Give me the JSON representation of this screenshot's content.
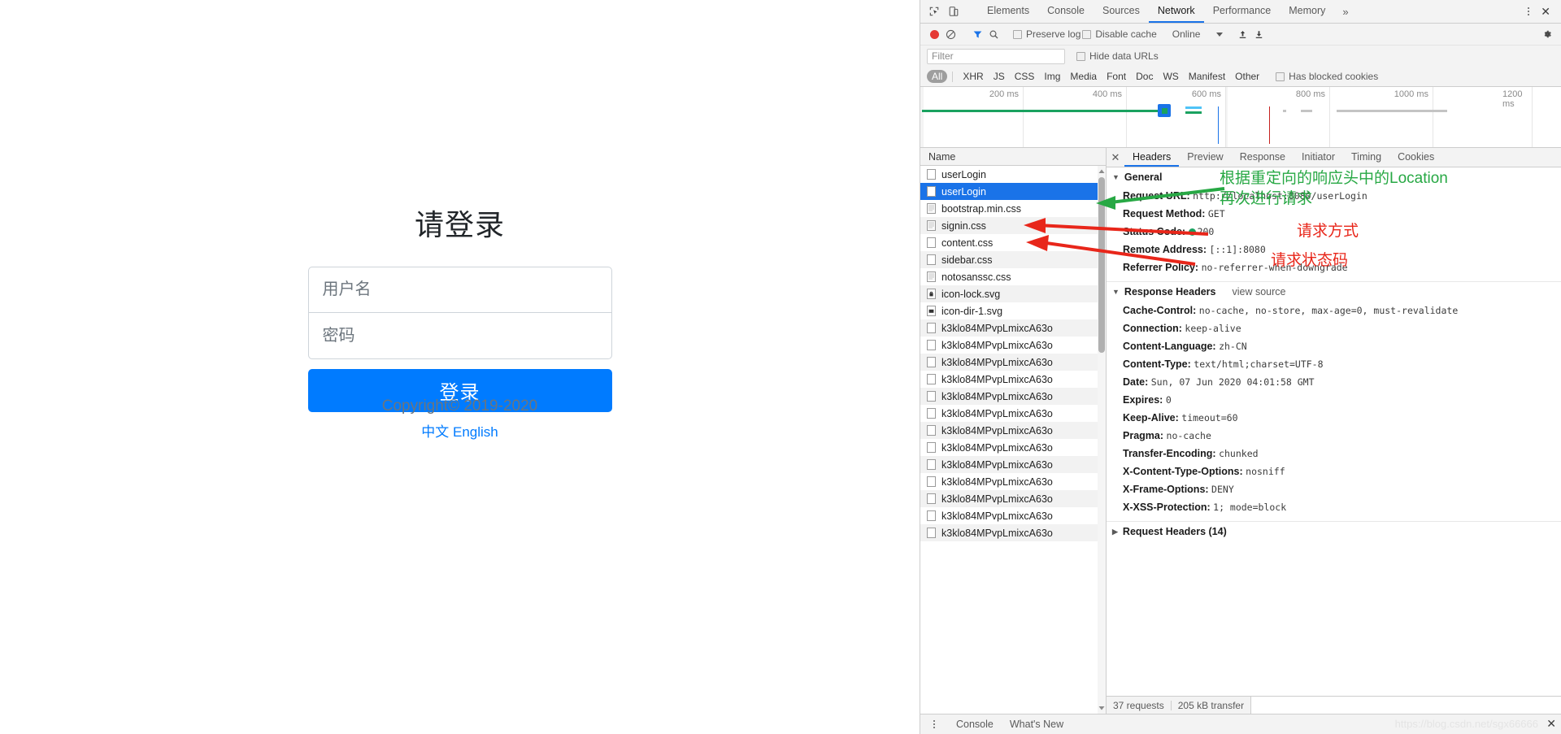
{
  "page": {
    "title": "请登录",
    "username_placeholder": "用户名",
    "password_placeholder": "密码",
    "username_value": "",
    "password_value": "",
    "login_button": "登录",
    "lang_zh": "中文",
    "lang_en": "English",
    "copyright": "Copyright© 2019-2020",
    "accent_color": "#007bff"
  },
  "devtools": {
    "tabs": [
      {
        "label": "Elements",
        "active": false
      },
      {
        "label": "Console",
        "active": false
      },
      {
        "label": "Sources",
        "active": false
      },
      {
        "label": "Network",
        "active": true
      },
      {
        "label": "Performance",
        "active": false
      },
      {
        "label": "Memory",
        "active": false
      }
    ],
    "more_tabs_icon": "chevron-double-right-icon",
    "inspect_icon": "inspect-cursor-icon",
    "device_icon": "device-toolbar-icon",
    "menu_icon": "kebab-menu-icon",
    "close_icon": "close-icon",
    "toolbar": {
      "record_icon": "record-circle-icon",
      "clear_icon": "clear-no-entry-icon",
      "filter_icon": "funnel-filter-icon",
      "search_icon": "search-magnifier-icon",
      "preserve_log": "Preserve log",
      "preserve_log_checked": false,
      "disable_cache": "Disable cache",
      "disable_cache_checked": false,
      "throttle_value": "Online",
      "import_icon": "upload-arrow-icon",
      "export_icon": "download-arrow-icon",
      "settings_icon": "gear-icon"
    },
    "filter": {
      "placeholder": "Filter",
      "value": "",
      "hide_data_urls": "Hide data URLs",
      "hide_data_urls_checked": false
    },
    "types": [
      "All",
      "XHR",
      "JS",
      "CSS",
      "Img",
      "Media",
      "Font",
      "Doc",
      "WS",
      "Manifest",
      "Other"
    ],
    "type_active": "All",
    "has_blocked_cookies": "Has blocked cookies",
    "has_blocked_cookies_checked": false,
    "overview": {
      "ticks": [
        "200 ms",
        "400 ms",
        "600 ms",
        "800 ms",
        "1000 ms",
        "1200 ms"
      ],
      "dom_content_loaded_color": "#1a73e8",
      "load_color": "#c5221f",
      "request_color": "#1aa260"
    },
    "requests": {
      "column_header": "Name",
      "rows": [
        {
          "name": "userLogin",
          "icon": "doc-icon",
          "selected": false
        },
        {
          "name": "userLogin",
          "icon": "doc-icon",
          "selected": true
        },
        {
          "name": "bootstrap.min.css",
          "icon": "stylesheet-icon",
          "selected": false
        },
        {
          "name": "signin.css",
          "icon": "stylesheet-icon",
          "selected": false
        },
        {
          "name": "content.css",
          "icon": "doc-icon",
          "selected": false
        },
        {
          "name": "sidebar.css",
          "icon": "doc-icon",
          "selected": false
        },
        {
          "name": "notosanssc.css",
          "icon": "stylesheet-icon",
          "selected": false
        },
        {
          "name": "icon-lock.svg",
          "icon": "lock-image-icon",
          "selected": false
        },
        {
          "name": "icon-dir-1.svg",
          "icon": "image-icon",
          "selected": false
        },
        {
          "name": "k3klo84MPvpLmixcA63o",
          "icon": "font-icon",
          "selected": false
        },
        {
          "name": "k3klo84MPvpLmixcA63o",
          "icon": "font-icon",
          "selected": false
        },
        {
          "name": "k3klo84MPvpLmixcA63o",
          "icon": "font-icon",
          "selected": false
        },
        {
          "name": "k3klo84MPvpLmixcA63o",
          "icon": "font-icon",
          "selected": false
        },
        {
          "name": "k3klo84MPvpLmixcA63o",
          "icon": "font-icon",
          "selected": false
        },
        {
          "name": "k3klo84MPvpLmixcA63o",
          "icon": "font-icon",
          "selected": false
        },
        {
          "name": "k3klo84MPvpLmixcA63o",
          "icon": "font-icon",
          "selected": false
        },
        {
          "name": "k3klo84MPvpLmixcA63o",
          "icon": "font-icon",
          "selected": false
        },
        {
          "name": "k3klo84MPvpLmixcA63o",
          "icon": "font-icon",
          "selected": false
        },
        {
          "name": "k3klo84MPvpLmixcA63o",
          "icon": "font-icon",
          "selected": false
        },
        {
          "name": "k3klo84MPvpLmixcA63o",
          "icon": "font-icon",
          "selected": false
        },
        {
          "name": "k3klo84MPvpLmixcA63o",
          "icon": "font-icon",
          "selected": false
        },
        {
          "name": "k3klo84MPvpLmixcA63o",
          "icon": "font-icon",
          "selected": false
        }
      ]
    },
    "detail_tabs": [
      {
        "label": "Headers",
        "active": true
      },
      {
        "label": "Preview",
        "active": false
      },
      {
        "label": "Response",
        "active": false
      },
      {
        "label": "Initiator",
        "active": false
      },
      {
        "label": "Timing",
        "active": false
      },
      {
        "label": "Cookies",
        "active": false
      }
    ],
    "headers": {
      "general_title": "General",
      "general": [
        {
          "key": "Request URL:",
          "value": "http://localhost:8080/userLogin"
        },
        {
          "key": "Request Method:",
          "value": "GET"
        },
        {
          "key": "Status Code:",
          "value": "200",
          "dot": true
        },
        {
          "key": "Remote Address:",
          "value": "[::1]:8080"
        },
        {
          "key": "Referrer Policy:",
          "value": "no-referrer-when-downgrade"
        }
      ],
      "response_title": "Response Headers",
      "view_source": "view source",
      "response": [
        {
          "key": "Cache-Control:",
          "value": "no-cache, no-store, max-age=0, must-revalidate"
        },
        {
          "key": "Connection:",
          "value": "keep-alive"
        },
        {
          "key": "Content-Language:",
          "value": "zh-CN"
        },
        {
          "key": "Content-Type:",
          "value": "text/html;charset=UTF-8"
        },
        {
          "key": "Date:",
          "value": "Sun, 07 Jun 2020 04:01:58 GMT"
        },
        {
          "key": "Expires:",
          "value": "0"
        },
        {
          "key": "Keep-Alive:",
          "value": "timeout=60"
        },
        {
          "key": "Pragma:",
          "value": "no-cache"
        },
        {
          "key": "Transfer-Encoding:",
          "value": "chunked"
        },
        {
          "key": "X-Content-Type-Options:",
          "value": "nosniff"
        },
        {
          "key": "X-Frame-Options:",
          "value": "DENY"
        },
        {
          "key": "X-XSS-Protection:",
          "value": "1; mode=block"
        }
      ],
      "request_headers_title": "Request Headers (14)"
    },
    "status_bar": {
      "requests": "37 requests",
      "transfer": "205 kB transfer"
    },
    "drawer": {
      "tabs": [
        "Console",
        "What's New"
      ],
      "watermark": "https://blog.csdn.net/sgx66666"
    }
  },
  "annotations": [
    {
      "text": "根据重定向的响应头中的Location\n再次进行请求",
      "color": "#27a844",
      "kind": "green-note"
    },
    {
      "text": "请求方式",
      "color": "#e8261a",
      "kind": "red-note"
    },
    {
      "text": "请求状态码",
      "color": "#e8261a",
      "kind": "red-note"
    }
  ]
}
